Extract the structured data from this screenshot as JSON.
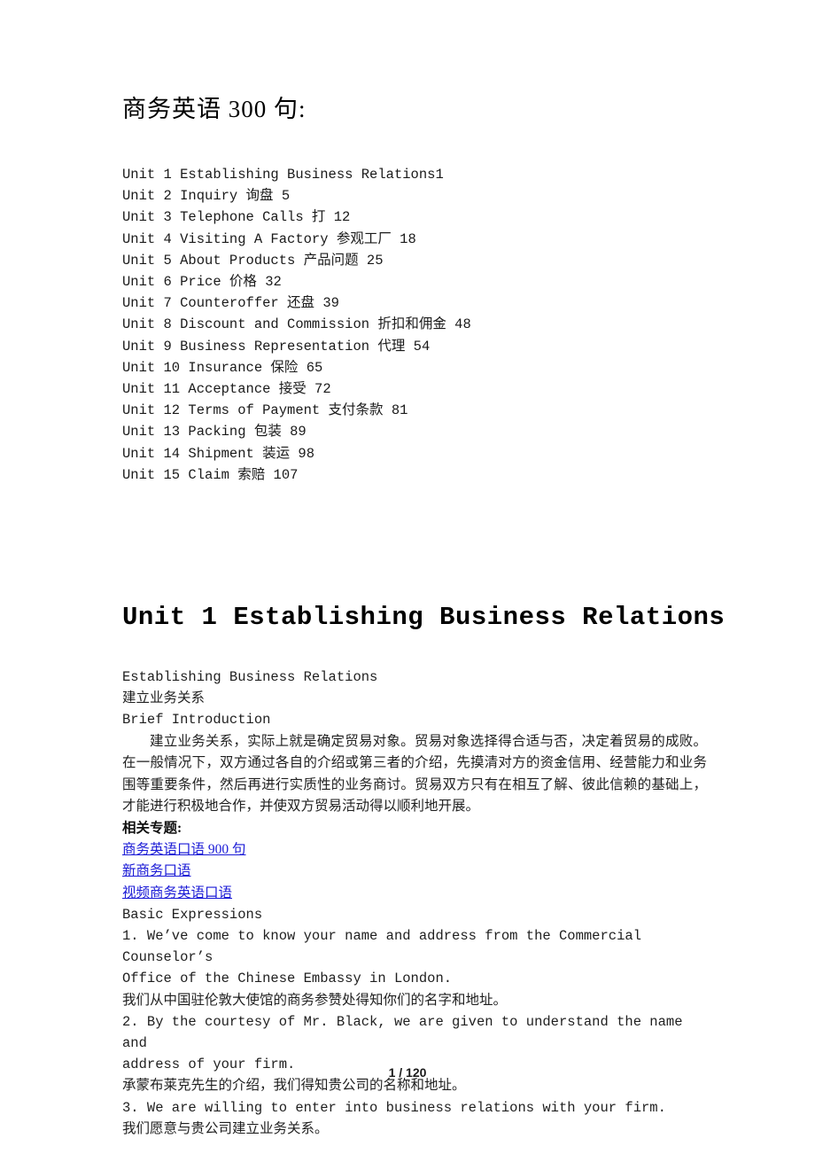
{
  "document": {
    "title": "商务英语 300 句:",
    "page_indicator": "1 / 120"
  },
  "toc": {
    "items": [
      {
        "line": "Unit  1  Establishing  Business  Relations1"
      },
      {
        "line": "Unit  2  Inquiry  询盘 5"
      },
      {
        "line": "Unit  3  Telephone  Calls  打 12"
      },
      {
        "line": "Unit  4  Visiting  A  Factory  参观工厂 18"
      },
      {
        "line": "Unit  5  About  Products  产品问题 25"
      },
      {
        "line": "Unit  6  Price  价格 32"
      },
      {
        "line": "Unit  7  Counteroffer  还盘 39"
      },
      {
        "line": "Unit  8  Discount  and  Commission  折扣和佣金 48"
      },
      {
        "line": "Unit  9  Business  Representation  代理 54"
      },
      {
        "line": "Unit  10  Insurance  保险 65"
      },
      {
        "line": "Unit  11  Acceptance  接受 72"
      },
      {
        "line": "Unit  12  Terms  of  Payment  支付条款 81"
      },
      {
        "line": "Unit  13  Packing  包装 89"
      },
      {
        "line": "Unit  14  Shipment  装运 98"
      },
      {
        "line": "Unit  15  Claim  索赔 107"
      }
    ]
  },
  "unit": {
    "heading": "Unit  1  Establishing  Business  Relations",
    "subtitle_en": "Establishing Business Relations",
    "subtitle_cn": "建立业务关系",
    "section_brief": "Brief Introduction",
    "brief_paragraph": "建立业务关系，实际上就是确定贸易对象。贸易对象选择得合适与否，决定着贸易的成败。在一般情况下，双方通过各自的介绍或第三者的介绍，先摸清对方的资金信用、经营能力和业务围等重要条件，然后再进行实质性的业务商讨。贸易双方只有在相互了解、彼此信赖的基础上，才能进行积极地合作，并使双方贸易活动得以顺利地开展。",
    "related_label": "相关专题:",
    "related_links": [
      {
        "text": "商务英语口语 900 句"
      },
      {
        "text": "新商务口语"
      },
      {
        "text": "视频商务英语口语"
      }
    ],
    "basic_expressions_label": "Basic Expressions",
    "expressions": [
      {
        "en": "1. We’ve come to know your name and address from the Commercial Counselor’s\nOffice of the Chinese Embassy in London.",
        "cn": "我们从中国驻伦敦大使馆的商务参赞处得知你们的名字和地址。"
      },
      {
        "en": "2. By the courtesy of Mr. Black, we are given to understand the name and\naddress of your firm.",
        "cn": "承蒙布莱克先生的介绍，我们得知贵公司的名称和地址。"
      },
      {
        "en": "3. We are willing to enter into business relations with your firm.",
        "cn": "我们愿意与贵公司建立业务关系。"
      }
    ]
  },
  "colors": {
    "link": "#1a1ad6",
    "text": "#1f1f1f",
    "background": "#ffffff"
  }
}
